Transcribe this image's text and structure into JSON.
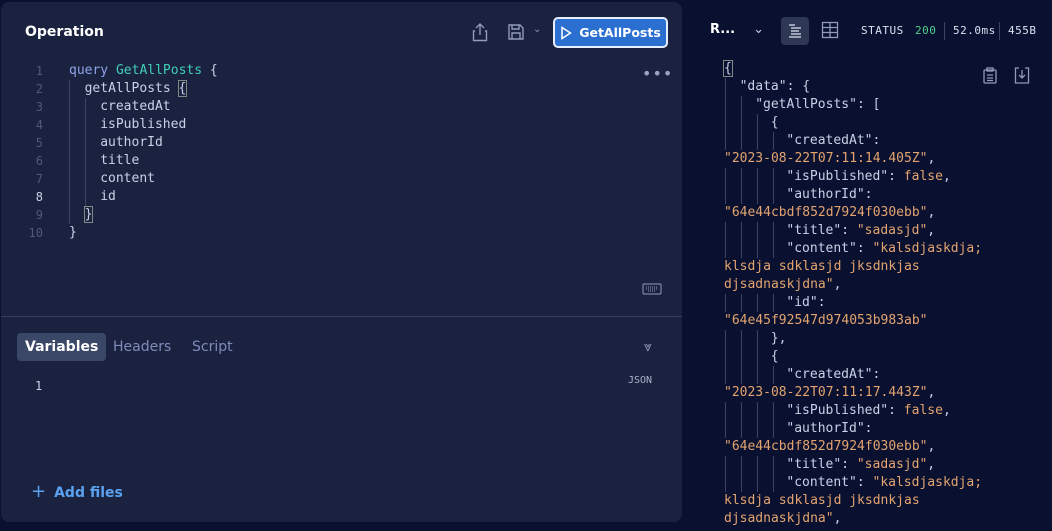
{
  "operation": {
    "title": "Operation",
    "run_label": "GetAllPosts",
    "lines": [
      {
        "n": "1",
        "parts": [
          {
            "t": "query ",
            "c": "kw"
          },
          {
            "t": "GetAllPosts",
            "c": "nm"
          },
          {
            "t": " {",
            "c": ""
          }
        ],
        "indent": 0
      },
      {
        "n": "2",
        "parts": [
          {
            "t": "getAllPosts ",
            "c": ""
          },
          {
            "t": "{",
            "c": "br"
          }
        ],
        "indent": 1
      },
      {
        "n": "3",
        "parts": [
          {
            "t": "createdAt",
            "c": ""
          }
        ],
        "indent": 2
      },
      {
        "n": "4",
        "parts": [
          {
            "t": "isPublished",
            "c": ""
          }
        ],
        "indent": 2
      },
      {
        "n": "5",
        "parts": [
          {
            "t": "authorId",
            "c": ""
          }
        ],
        "indent": 2
      },
      {
        "n": "6",
        "parts": [
          {
            "t": "title",
            "c": ""
          }
        ],
        "indent": 2
      },
      {
        "n": "7",
        "parts": [
          {
            "t": "content",
            "c": ""
          }
        ],
        "indent": 2
      },
      {
        "n": "8",
        "parts": [
          {
            "t": "id",
            "c": ""
          }
        ],
        "indent": 2,
        "active": true
      },
      {
        "n": "9",
        "parts": [
          {
            "t": "}",
            "c": "br"
          }
        ],
        "indent": 1
      },
      {
        "n": "10",
        "parts": [
          {
            "t": "}",
            "c": ""
          }
        ],
        "indent": 0
      }
    ]
  },
  "bottom": {
    "tabs": [
      "Variables",
      "Headers",
      "Script"
    ],
    "active_tab": "Variables",
    "mode": "JSON",
    "line": "1",
    "add_files": "Add files"
  },
  "response": {
    "title": "R...",
    "status_label": "STATUS",
    "status_code": "200",
    "time": "52.0ms",
    "size": "455B",
    "colors": {
      "status_ok": "#4fcf8a",
      "string": "#e3a46f",
      "accent": "#2b6fd1"
    },
    "lines": [
      {
        "i": 0,
        "p": [
          {
            "t": "{",
            "c": "br"
          }
        ]
      },
      {
        "i": 1,
        "p": [
          {
            "t": "\"data\"",
            "c": "k"
          },
          {
            "t": ": {",
            "c": "p"
          }
        ]
      },
      {
        "i": 2,
        "p": [
          {
            "t": "\"getAllPosts\"",
            "c": "k"
          },
          {
            "t": ": [",
            "c": "p"
          }
        ]
      },
      {
        "i": 3,
        "p": [
          {
            "t": "{",
            "c": "p"
          }
        ]
      },
      {
        "i": 4,
        "p": [
          {
            "t": "\"createdAt\"",
            "c": "k"
          },
          {
            "t": ":",
            "c": "p"
          }
        ]
      },
      {
        "i": 0,
        "w": 1,
        "p": [
          {
            "t": "\"2023-08-22T07:11:14.405Z\"",
            "c": "s"
          },
          {
            "t": ",",
            "c": "p"
          }
        ]
      },
      {
        "i": 4,
        "p": [
          {
            "t": "\"isPublished\"",
            "c": "k"
          },
          {
            "t": ": ",
            "c": "p"
          },
          {
            "t": "false",
            "c": "s"
          },
          {
            "t": ",",
            "c": "p"
          }
        ]
      },
      {
        "i": 4,
        "p": [
          {
            "t": "\"authorId\"",
            "c": "k"
          },
          {
            "t": ":",
            "c": "p"
          }
        ]
      },
      {
        "i": 0,
        "w": 1,
        "p": [
          {
            "t": "\"64e44cbdf852d7924f030ebb\"",
            "c": "s"
          },
          {
            "t": ",",
            "c": "p"
          }
        ]
      },
      {
        "i": 4,
        "p": [
          {
            "t": "\"title\"",
            "c": "k"
          },
          {
            "t": ": ",
            "c": "p"
          },
          {
            "t": "\"sadasjd\"",
            "c": "s"
          },
          {
            "t": ",",
            "c": "p"
          }
        ]
      },
      {
        "i": 4,
        "p": [
          {
            "t": "\"content\"",
            "c": "k"
          },
          {
            "t": ": ",
            "c": "p"
          },
          {
            "t": "\"kalsdjaskdja;",
            "c": "s"
          }
        ]
      },
      {
        "i": 0,
        "w": 1,
        "p": [
          {
            "t": "klsdja sdklasjd jksdnkjas",
            "c": "s"
          }
        ]
      },
      {
        "i": 0,
        "w": 1,
        "p": [
          {
            "t": "djsadnaskjdna\"",
            "c": "s"
          },
          {
            "t": ",",
            "c": "p"
          }
        ]
      },
      {
        "i": 4,
        "p": [
          {
            "t": "\"id\"",
            "c": "k"
          },
          {
            "t": ":",
            "c": "p"
          }
        ]
      },
      {
        "i": 0,
        "w": 1,
        "p": [
          {
            "t": "\"64e45f92547d974053b983ab\"",
            "c": "s"
          }
        ]
      },
      {
        "i": 3,
        "p": [
          {
            "t": "},",
            "c": "p"
          }
        ]
      },
      {
        "i": 3,
        "p": [
          {
            "t": "{",
            "c": "p"
          }
        ]
      },
      {
        "i": 4,
        "p": [
          {
            "t": "\"createdAt\"",
            "c": "k"
          },
          {
            "t": ":",
            "c": "p"
          }
        ]
      },
      {
        "i": 0,
        "w": 1,
        "p": [
          {
            "t": "\"2023-08-22T07:11:17.443Z\"",
            "c": "s"
          },
          {
            "t": ",",
            "c": "p"
          }
        ]
      },
      {
        "i": 4,
        "p": [
          {
            "t": "\"isPublished\"",
            "c": "k"
          },
          {
            "t": ": ",
            "c": "p"
          },
          {
            "t": "false",
            "c": "s"
          },
          {
            "t": ",",
            "c": "p"
          }
        ]
      },
      {
        "i": 4,
        "p": [
          {
            "t": "\"authorId\"",
            "c": "k"
          },
          {
            "t": ":",
            "c": "p"
          }
        ]
      },
      {
        "i": 0,
        "w": 1,
        "p": [
          {
            "t": "\"64e44cbdf852d7924f030ebb\"",
            "c": "s"
          },
          {
            "t": ",",
            "c": "p"
          }
        ]
      },
      {
        "i": 4,
        "p": [
          {
            "t": "\"title\"",
            "c": "k"
          },
          {
            "t": ": ",
            "c": "p"
          },
          {
            "t": "\"sadasjd\"",
            "c": "s"
          },
          {
            "t": ",",
            "c": "p"
          }
        ]
      },
      {
        "i": 4,
        "p": [
          {
            "t": "\"content\"",
            "c": "k"
          },
          {
            "t": ": ",
            "c": "p"
          },
          {
            "t": "\"kalsdjaskdja;",
            "c": "s"
          }
        ]
      },
      {
        "i": 0,
        "w": 1,
        "p": [
          {
            "t": "klsdja sdklasjd jksdnkjas",
            "c": "s"
          }
        ]
      },
      {
        "i": 0,
        "w": 1,
        "p": [
          {
            "t": "djsadnaskjdna\"",
            "c": "s"
          },
          {
            "t": ",",
            "c": "p"
          }
        ]
      }
    ]
  }
}
